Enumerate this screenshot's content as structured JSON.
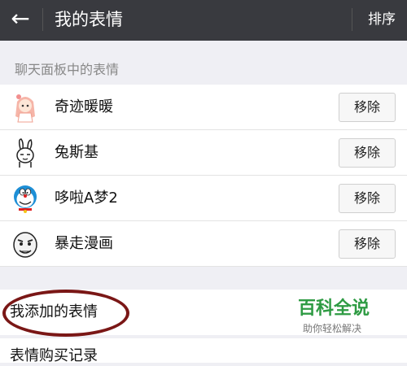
{
  "header": {
    "title": "我的表情",
    "sort_label": "排序"
  },
  "section": {
    "label": "聊天面板中的表情"
  },
  "stickers": [
    {
      "name": "奇迹暖暖",
      "icon": "girl-sticker-icon",
      "remove_label": "移除"
    },
    {
      "name": "兔斯基",
      "icon": "rabbit-sticker-icon",
      "remove_label": "移除"
    },
    {
      "name": "哆啦A梦2",
      "icon": "doraemon-sticker-icon",
      "remove_label": "移除"
    },
    {
      "name": "暴走漫画",
      "icon": "rage-face-sticker-icon",
      "remove_label": "移除"
    }
  ],
  "my_added": {
    "label": "我添加的表情"
  },
  "purchase_history": {
    "label": "表情购买记录"
  },
  "watermark": {
    "title": "百科全说",
    "subtitle": "助你轻松解决"
  }
}
